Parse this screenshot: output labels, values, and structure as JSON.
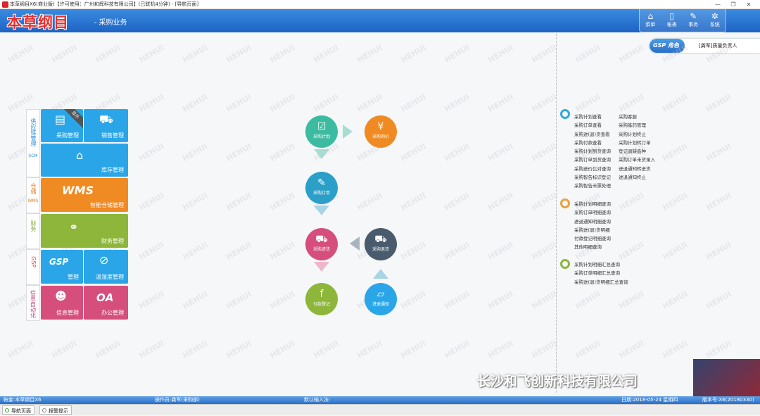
{
  "titlebar": {
    "title": "本草纲目X6(商业版)【许可使用：广州和辉科技有限公司】(已联机4分钟) - [导航页面]",
    "min": "—",
    "max": "❐",
    "close": "✕"
  },
  "header": {
    "logo": "本草纲目",
    "module": "- 采购业务",
    "buttons": [
      {
        "label": "菜单",
        "icon": "⌂"
      },
      {
        "label": "帐表",
        "icon": "▯"
      },
      {
        "label": "事务",
        "icon": "✎"
      },
      {
        "label": "系统",
        "icon": "✲"
      }
    ]
  },
  "gsp": {
    "tag": "GSP 角色",
    "role": "[龚军]质量负责人"
  },
  "watermark": "HEHUI",
  "sidenav": {
    "groups": [
      {
        "label": "供应链管理",
        "sub": "SCM"
      },
      {
        "label": "仓储",
        "sub": "WMS"
      },
      {
        "label": "财务",
        "sub": ""
      },
      {
        "label": "GSP",
        "sub": ""
      },
      {
        "label": "信息自动化",
        "sub": ""
      }
    ],
    "tiles": {
      "purchase": "采购管理",
      "purchase_badge": "显示",
      "sales": "销售管理",
      "inventory": "库存管理",
      "wms_logo": "WMS",
      "wms": "智能仓储管理",
      "finance": "财务管理",
      "gsp_logo": "GSP",
      "gsp": "管理",
      "temp": "温湿度管理",
      "info": "信息管理",
      "oa_logo": "OA",
      "office": "办公管理"
    }
  },
  "flow": {
    "plan": "采购计划",
    "price": "采购询价",
    "order": "采购订单",
    "arrival": "采购进货",
    "return": "采购退货",
    "payment": "付款登记",
    "notice": "进退通知"
  },
  "links": {
    "col1": [
      "采购计划查看",
      "采购订单查看",
      "采购进(退)货查看",
      "采购付款查看",
      "采购计划到货查询",
      "采购订单到货查询",
      "采购进价比对查询",
      "采购智告标识登记",
      "采购智告未票处理"
    ],
    "col2": [
      "采购客服",
      "采购基药管理",
      "采购计划终止",
      "采购计划转订单",
      "登记退缺品种",
      "采购订单未货录入",
      "进退通知转进货",
      "进退通知终止"
    ],
    "col3": [
      "采购计划明细查询",
      "采购订单明细查询",
      "进退通知明细查询",
      "采购进(退)货明细",
      "付款登记明细查询",
      "其他明细查询"
    ],
    "col4": [
      "采购计划明细汇总查询",
      "采购订单明细汇总查询",
      "采购进(退)货明细汇总查询"
    ]
  },
  "company": "长沙和飞创新科技有限公司",
  "status": {
    "account": "帐套:本草纲目X6",
    "operator": "操作员:龚军(采购部)",
    "input": "默认输入法:",
    "date": "日期:2018-05-24 星期四",
    "version": "版本号:X6(20180330)"
  },
  "tabs": {
    "nav": "导航页面",
    "alert": "报警提示"
  },
  "colors": {
    "blue": "#2aa6e8",
    "orange": "#f08a22",
    "green": "#8db63a",
    "pink": "#d64e7c",
    "teal": "#3dbba0",
    "dark": "#4a5b6d"
  }
}
